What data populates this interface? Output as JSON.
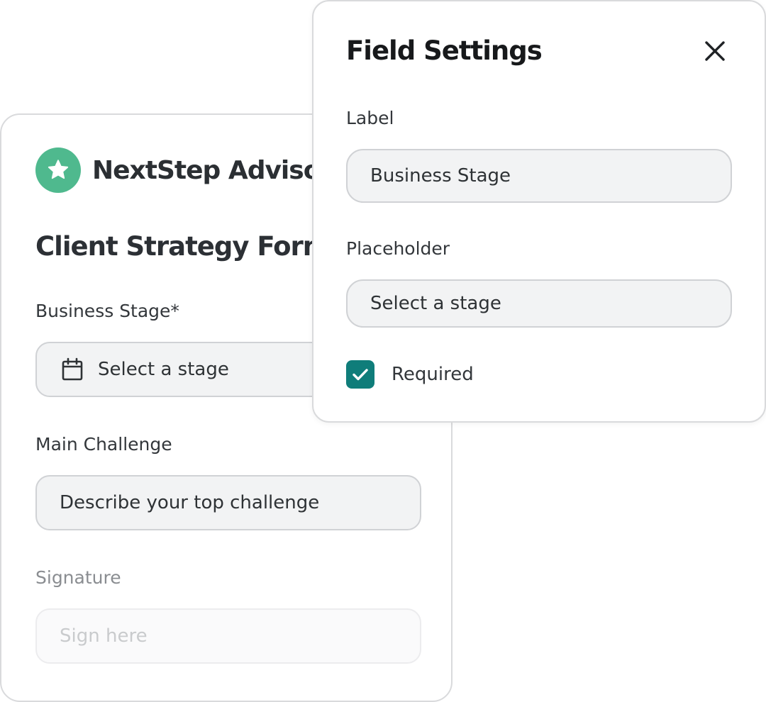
{
  "form": {
    "brand_name": "NextStep Advisory",
    "title": "Client Strategy Form",
    "fields": [
      {
        "label": "Business Stage*",
        "placeholder": "Select a stage",
        "icon": "calendar-icon"
      },
      {
        "label": "Main Challenge",
        "placeholder": "Describe your top challenge"
      },
      {
        "label": "Signature",
        "placeholder": "Sign here"
      }
    ]
  },
  "panel": {
    "title": "Field Settings",
    "label_label": "Label",
    "label_value": "Business Stage",
    "placeholder_label": "Placeholder",
    "placeholder_value": "Select a stage",
    "required_label": "Required",
    "required_checked": true
  },
  "colors": {
    "brand_green": "#4fb98e",
    "checkbox_teal": "#0f7d7a"
  }
}
